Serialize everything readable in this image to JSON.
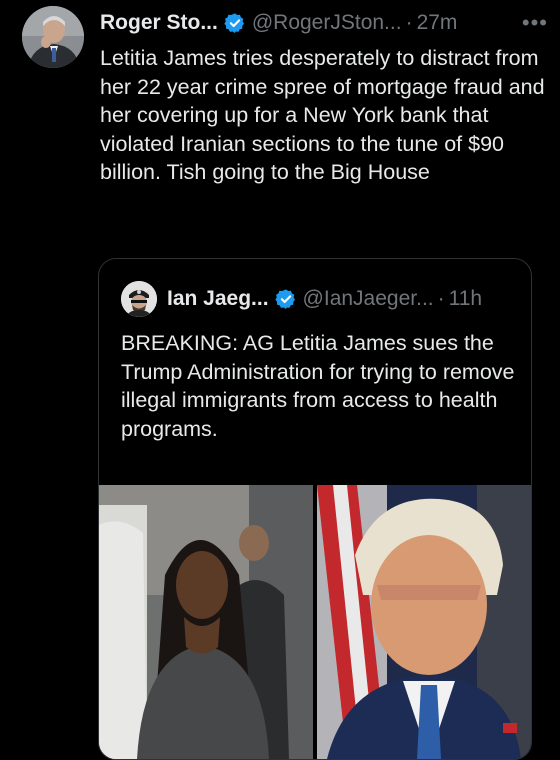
{
  "post": {
    "author_name": "Roger Sto...",
    "handle": "@RogerJSton...",
    "separator": "·",
    "time": "27m",
    "more_label": "•••",
    "text": "Letitia James tries desperately to distract from her 22 year crime spree of mortgage fraud and her covering up for a New York bank that violated Iranian sections to the tune of $90 billion. Tish going to the Big House"
  },
  "quoted_post": {
    "author_name": "Ian Jaeg...",
    "handle": "@IanJaeger...",
    "separator": "·",
    "time": "11h",
    "text": "BREAKING: AG Letitia James sues the Trump Administration for trying to remove illegal immigrants from access to health programs."
  },
  "icons": {
    "verified": "verified-badge-icon",
    "more": "more-options-icon"
  },
  "colors": {
    "background": "#000000",
    "text_primary": "#e7e9ea",
    "text_secondary": "#71767b",
    "verified_blue": "#1d9bf0",
    "border": "#2f3336"
  }
}
